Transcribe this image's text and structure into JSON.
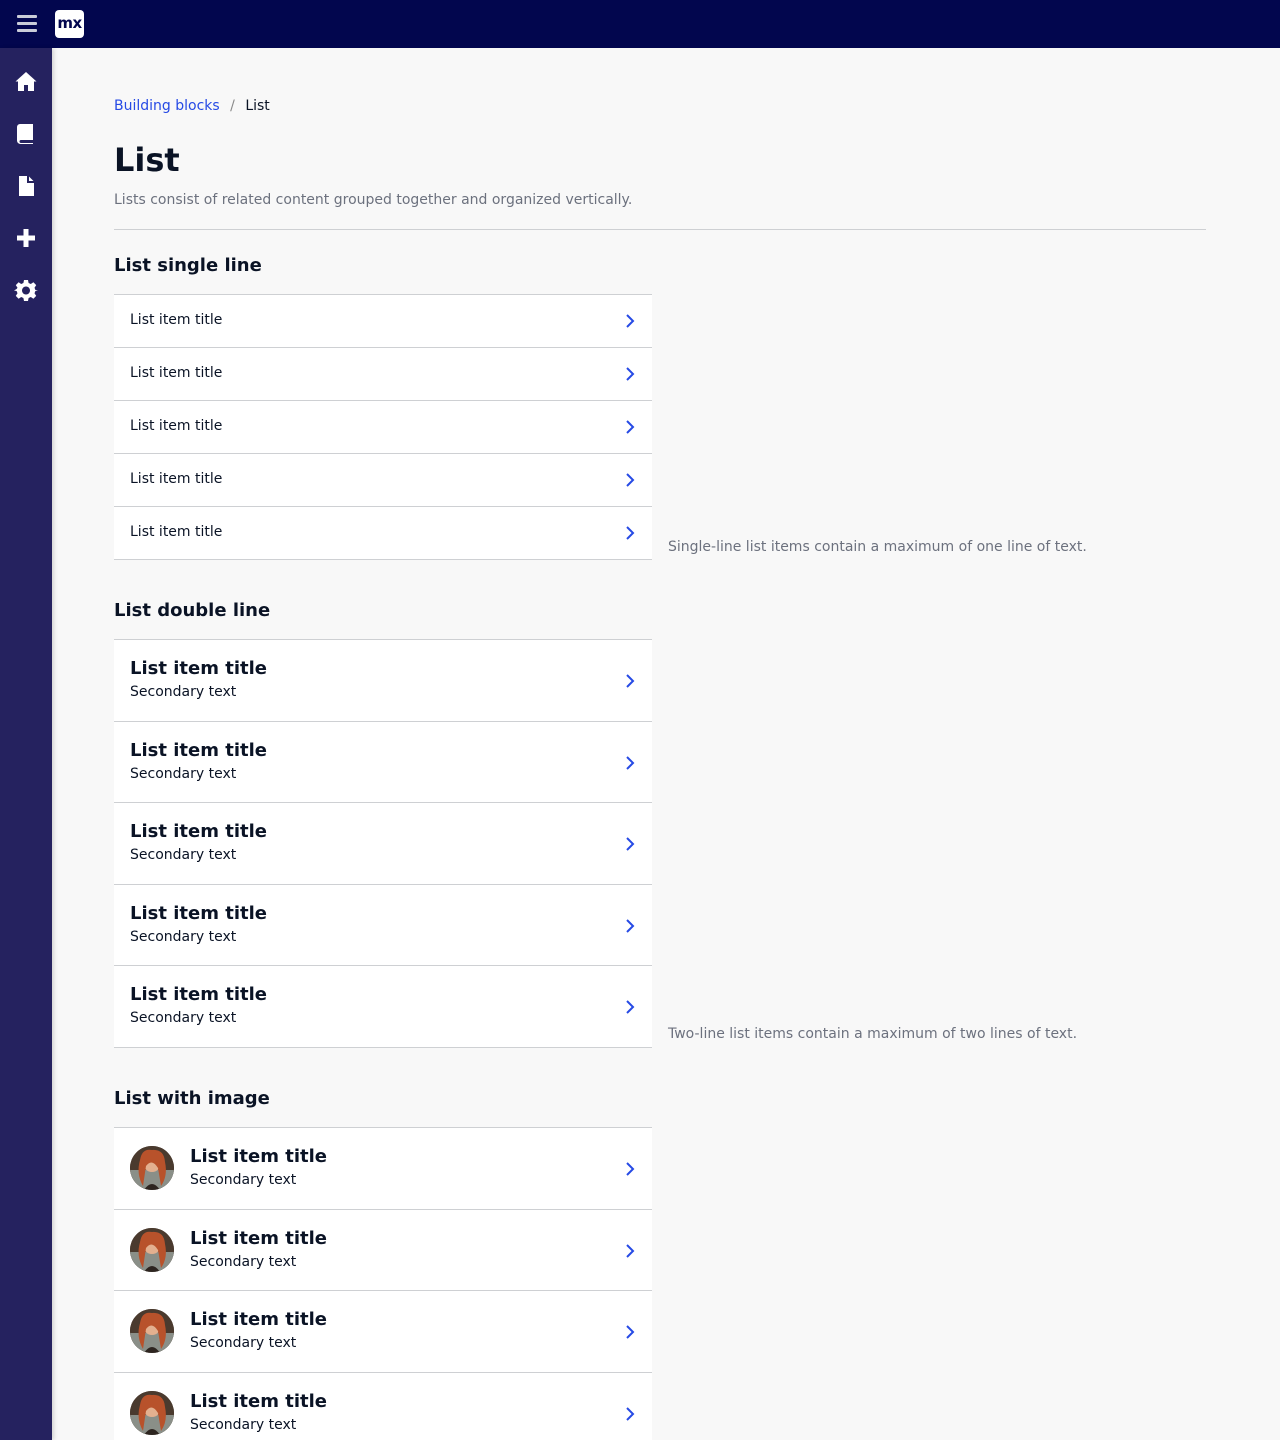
{
  "app": {
    "logo_text": "mx"
  },
  "sidebar": {
    "items": [
      {
        "icon": "home-icon"
      },
      {
        "icon": "book-icon"
      },
      {
        "icon": "file-icon"
      },
      {
        "icon": "plus-icon"
      },
      {
        "icon": "gear-icon"
      }
    ]
  },
  "breadcrumb": {
    "parent": "Building blocks",
    "separator": "/",
    "current": "List"
  },
  "page": {
    "title": "List",
    "description": "Lists consist of related content grouped together and organized vertically."
  },
  "sections": {
    "single": {
      "title": "List single line",
      "note": "Single-line list items contain a maximum of one line of text.",
      "items": [
        {
          "title": "List item title"
        },
        {
          "title": "List item title"
        },
        {
          "title": "List item title"
        },
        {
          "title": "List item title"
        },
        {
          "title": "List item title"
        }
      ]
    },
    "double": {
      "title": "List double line",
      "note": "Two-line list items contain a maximum of two lines of text.",
      "items": [
        {
          "title": "List item title",
          "secondary": "Secondary text"
        },
        {
          "title": "List item title",
          "secondary": "Secondary text"
        },
        {
          "title": "List item title",
          "secondary": "Secondary text"
        },
        {
          "title": "List item title",
          "secondary": "Secondary text"
        },
        {
          "title": "List item title",
          "secondary": "Secondary text"
        }
      ]
    },
    "image": {
      "title": "List with image",
      "items": [
        {
          "title": "List item title",
          "secondary": "Secondary text"
        },
        {
          "title": "List item title",
          "secondary": "Secondary text"
        },
        {
          "title": "List item title",
          "secondary": "Secondary text"
        },
        {
          "title": "List item title",
          "secondary": "Secondary text"
        }
      ]
    }
  },
  "colors": {
    "topbar": "#02064e",
    "sidebar": "#25225f",
    "accent": "#264ae5",
    "border": "#ced0d3",
    "muted_text": "#6c717e"
  }
}
